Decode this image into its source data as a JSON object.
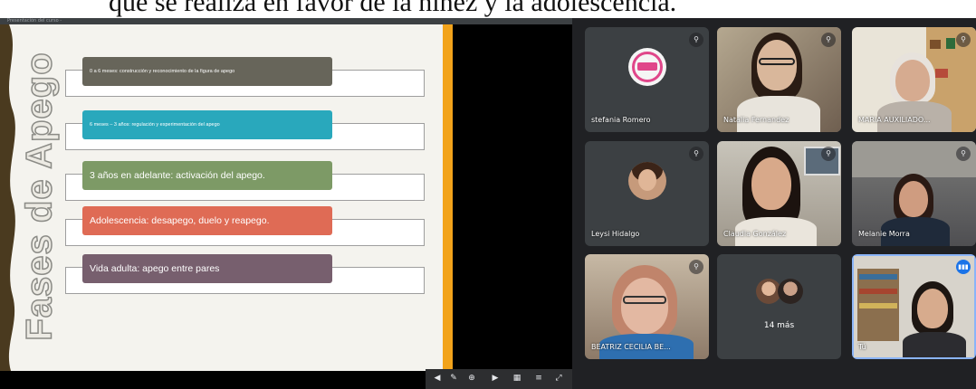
{
  "caption": {
    "text": "que se realiza en favor de la niñez y la adolescencia."
  },
  "share": {
    "title": "Presentación del curso - ",
    "slide": {
      "title": "Fases de Apego",
      "phases": [
        {
          "text": "0 a 6 meses: construcción y reconocimiento de la figura de apego",
          "color": "#67655a"
        },
        {
          "text": "6 meses – 3 años: regulación y experimentación del apego",
          "color": "#29a8bc"
        },
        {
          "text": "3 años en adelante: activación del apego.",
          "color": "#7d9a66"
        },
        {
          "text": "Adolescencia: desapego, duelo y reapego.",
          "color": "#df6b55"
        },
        {
          "text": "Vida adulta: apego entre pares",
          "color": "#775f6e"
        }
      ]
    }
  },
  "participants": [
    {
      "name": "stefania Romero",
      "type": "avatar"
    },
    {
      "name": "Natalia Fernandez",
      "type": "video"
    },
    {
      "name": "MARIA AUXILIADO...",
      "type": "video"
    },
    {
      "name": "Leysi Hidalgo",
      "type": "avatar"
    },
    {
      "name": "Claudia González",
      "type": "video"
    },
    {
      "name": "Melanie Morra",
      "type": "video"
    },
    {
      "name": "BEATRIZ CECILIA BE...",
      "type": "video"
    },
    {
      "name": "",
      "more_label": "14 más",
      "type": "more"
    },
    {
      "name": "Tú",
      "type": "video"
    }
  ],
  "icons": {
    "mic_muted": "mic-off-icon",
    "speaking": "audio-level-icon"
  }
}
